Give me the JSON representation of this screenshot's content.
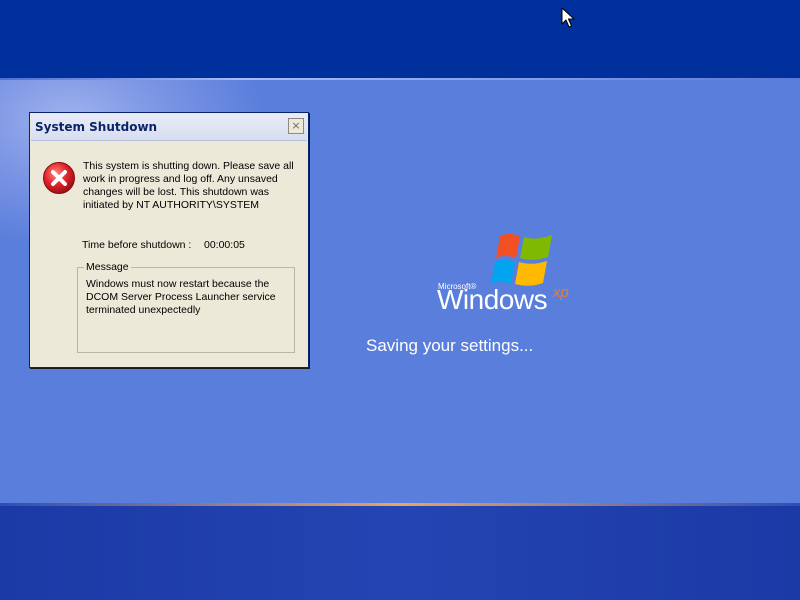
{
  "dialog": {
    "title": "System Shutdown",
    "close_label": "×",
    "message": "This system is shutting down. Please save all work in progress and log off. Any unsaved changes will be lost. This shutdown was initiated by NT AUTHORITY\\SYSTEM",
    "time_label": "Time before shutdown :",
    "time_value": "00:00:05",
    "group_label": "Message",
    "group_message": "Windows must now restart because the DCOM Server Process Launcher service terminated unexpectedly",
    "icon": "error-icon"
  },
  "logo": {
    "microsoft": "Microsoft®",
    "windows": "Windows",
    "xp": "xp",
    "icon": "windows-flag-icon"
  },
  "status": {
    "text": "Saving your settings..."
  },
  "colors": {
    "top_band": "#00309c",
    "middle": "#5a7edc",
    "bottom_band": "#1c3aa6",
    "dialog_bg": "#ece9d8",
    "xp_accent": "#f47a20",
    "error_red": "#d2232a"
  }
}
